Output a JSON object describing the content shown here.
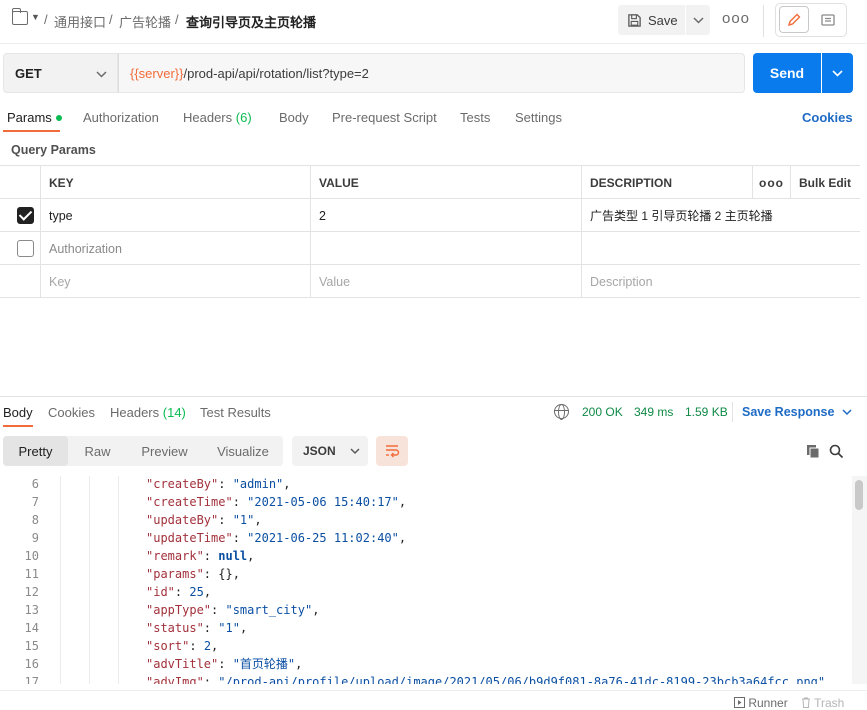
{
  "breadcrumb": {
    "items": [
      "通用接口",
      "广告轮播",
      "查询引导页及主页轮播"
    ],
    "separator": "/"
  },
  "toolbar": {
    "save_label": "Save",
    "more_label": "ooo"
  },
  "request": {
    "method": "GET",
    "url_var": "{{server}}",
    "url_path": "/prod-api/api/rotation/list?type=2",
    "send_label": "Send"
  },
  "request_tabs": {
    "params": "Params",
    "authorization": "Authorization",
    "headers": "Headers",
    "headers_count": "(6)",
    "body": "Body",
    "prerequest": "Pre-request Script",
    "tests": "Tests",
    "settings": "Settings",
    "cookies": "Cookies"
  },
  "query_params": {
    "title": "Query Params",
    "headers": {
      "key": "KEY",
      "value": "VALUE",
      "description": "DESCRIPTION",
      "more": "ooo",
      "bulk_edit": "Bulk Edit"
    },
    "rows": [
      {
        "checked": true,
        "key": "type",
        "value": "2",
        "description": "广告类型 1 引导页轮播 2 主页轮播"
      },
      {
        "checked": false,
        "key": "Authorization",
        "value": "",
        "description": ""
      }
    ],
    "placeholder": {
      "key": "Key",
      "value": "Value",
      "description": "Description"
    }
  },
  "response_tabs": {
    "body": "Body",
    "cookies": "Cookies",
    "headers": "Headers",
    "headers_count": "(14)",
    "test_results": "Test Results"
  },
  "response_status": {
    "status": "200 OK",
    "time": "349 ms",
    "size": "1.59 KB",
    "save_response": "Save Response"
  },
  "format_tabs": {
    "pretty": "Pretty",
    "raw": "Raw",
    "preview": "Preview",
    "visualize": "Visualize",
    "language": "JSON"
  },
  "code_lines": [
    {
      "n": "6",
      "key": "\"createBy\"",
      "sep": ": ",
      "val": "\"admin\"",
      "type": "s",
      "tail": ","
    },
    {
      "n": "7",
      "key": "\"createTime\"",
      "sep": ": ",
      "val": "\"2021-05-06 15:40:17\"",
      "type": "s",
      "tail": ","
    },
    {
      "n": "8",
      "key": "\"updateBy\"",
      "sep": ": ",
      "val": "\"1\"",
      "type": "s",
      "tail": ","
    },
    {
      "n": "9",
      "key": "\"updateTime\"",
      "sep": ": ",
      "val": "\"2021-06-25 11:02:40\"",
      "type": "s",
      "tail": ","
    },
    {
      "n": "10",
      "key": "\"remark\"",
      "sep": ": ",
      "val": "null",
      "type": "nl",
      "tail": ","
    },
    {
      "n": "11",
      "key": "\"params\"",
      "sep": ": ",
      "val": "{}",
      "type": "p",
      "tail": ","
    },
    {
      "n": "12",
      "key": "\"id\"",
      "sep": ": ",
      "val": "25",
      "type": "n",
      "tail": ","
    },
    {
      "n": "13",
      "key": "\"appType\"",
      "sep": ": ",
      "val": "\"smart_city\"",
      "type": "s",
      "tail": ","
    },
    {
      "n": "14",
      "key": "\"status\"",
      "sep": ": ",
      "val": "\"1\"",
      "type": "s",
      "tail": ","
    },
    {
      "n": "15",
      "key": "\"sort\"",
      "sep": ": ",
      "val": "2",
      "type": "n",
      "tail": ","
    },
    {
      "n": "16",
      "key": "\"advTitle\"",
      "sep": ": ",
      "val": "\"首页轮播\"",
      "type": "s",
      "tail": ","
    },
    {
      "n": "17",
      "key": "\"advImg\"",
      "sep": ": ",
      "val": "\"/prod-api/profile/upload/image/2021/05/06/b9d9f081-8a76-41dc-8199-23bcb3a64fcc.png\"",
      "type": "s",
      "tail": ""
    }
  ],
  "footer": {
    "runner": "Runner",
    "trash": "Trash"
  },
  "colors": {
    "accent": "#f26b3a",
    "send_blue": "#097bed",
    "link_blue": "#1e6bc6",
    "status_green": "#0e8a45",
    "tab_green": "#0cbb52"
  },
  "icons": [
    "collection-icon",
    "chevron-down-icon",
    "save-icon",
    "more-icon",
    "edit-icon",
    "documentation-icon",
    "globe-icon",
    "wrap-lines-icon",
    "copy-icon",
    "search-icon",
    "runner-icon",
    "trash-icon"
  ]
}
